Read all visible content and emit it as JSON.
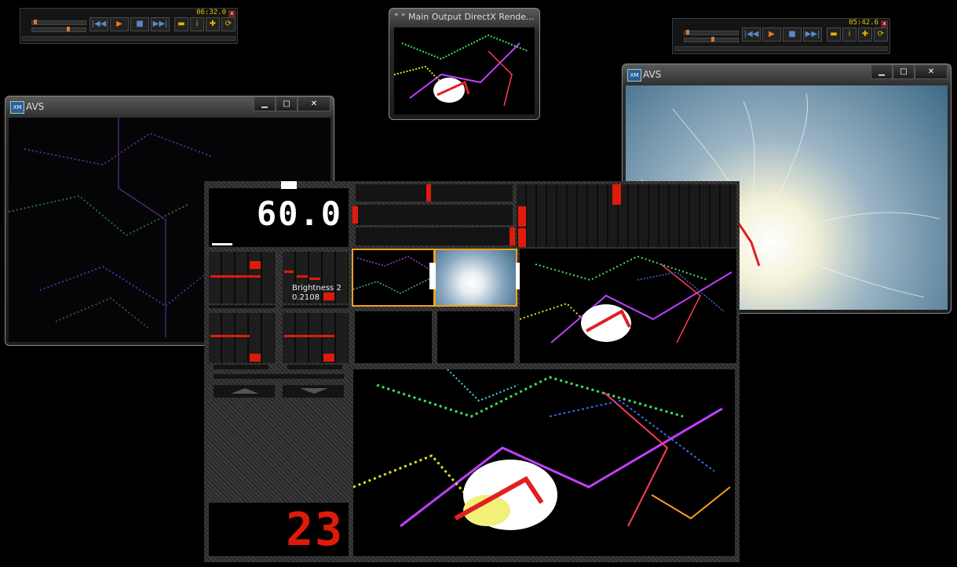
{
  "player_left": {
    "time": "06:32.0",
    "close_icon": "close-icon",
    "position": 0.55
  },
  "player_right": {
    "time": "05:42.6",
    "close_icon": "close-icon",
    "position": 0.45
  },
  "player_buttons": [
    "|◀◀",
    "▶",
    "■",
    "▶▶|"
  ],
  "player_tools": [
    "folder-icon",
    "info-icon",
    "wrench-icon",
    "shuffle-icon"
  ],
  "main_output": {
    "title": "° ° Main Output   DirectX Rende..."
  },
  "avs_left": {
    "title": "AVS"
  },
  "avs_right": {
    "title": "AVS"
  },
  "app_icon_text": "XM",
  "window_controls": {
    "minimize": "▁",
    "maximize": "□",
    "close": "✕"
  },
  "panel": {
    "fps": "60.0",
    "counter": "23",
    "param_label": "Brightness 2",
    "param_value": "0.2108"
  },
  "colors": {
    "accent_red": "#e01a0a",
    "selection_orange": "#f0a020",
    "avs_right_bg": "#3d6a88"
  }
}
